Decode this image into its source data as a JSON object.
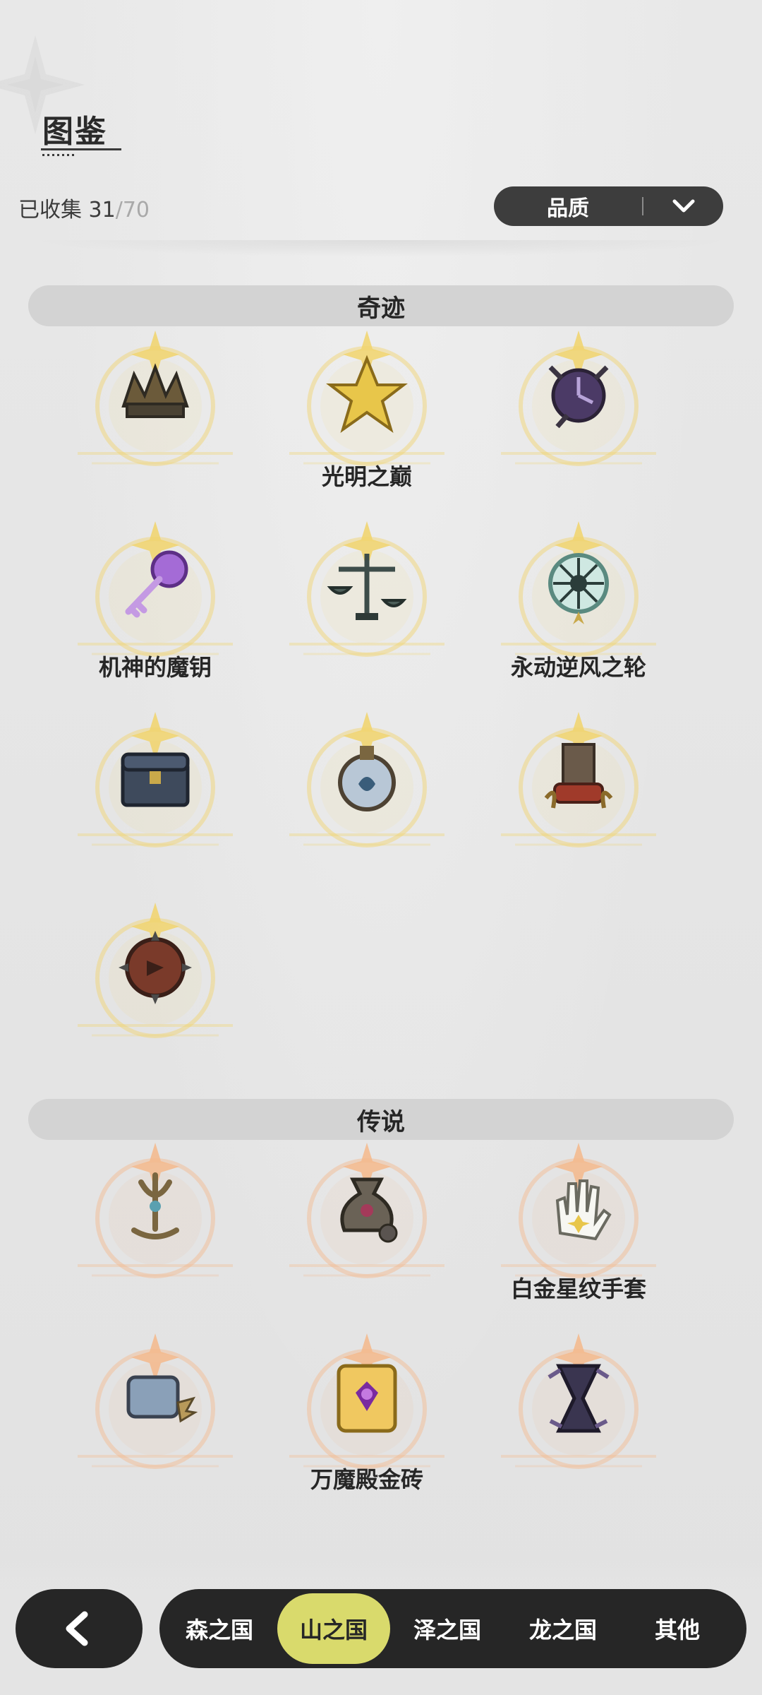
{
  "header": {
    "title": "图鉴",
    "collected_label": "已收集 31",
    "collected_total": "/70",
    "sort_label": "品质",
    "sort_icon": "chevron-down-icon"
  },
  "sections": [
    {
      "title": "奇迹",
      "items": [
        {
          "name": "",
          "icon": "bronze-broken-crown-icon",
          "accent": "#f1d36b"
        },
        {
          "name": "光明之巅",
          "icon": "golden-star-crystal-icon",
          "accent": "#f1d36b"
        },
        {
          "name": "",
          "icon": "purple-clock-icon",
          "accent": "#f1d36b"
        },
        {
          "name": "机神的魔钥",
          "icon": "purple-key-icon",
          "accent": "#f1d36b"
        },
        {
          "name": "",
          "icon": "bronze-scales-icon",
          "accent": "#f1d36b"
        },
        {
          "name": "永动逆风之轮",
          "icon": "wind-wheel-icon",
          "accent": "#f1d36b"
        },
        {
          "name": "",
          "icon": "treasure-chest-icon",
          "accent": "#f1d36b"
        },
        {
          "name": "",
          "icon": "flask-orb-icon",
          "accent": "#f1d36b"
        },
        {
          "name": "",
          "icon": "red-throne-icon",
          "accent": "#f1d36b"
        },
        {
          "name": "",
          "icon": "bronze-shield-icon",
          "accent": "#f1d36b"
        }
      ]
    },
    {
      "title": "传说",
      "items": [
        {
          "name": "",
          "icon": "bronze-trident-icon",
          "accent": "#f4b98b"
        },
        {
          "name": "",
          "icon": "bronze-sack-icon",
          "accent": "#f4b98b"
        },
        {
          "name": "白金星纹手套",
          "icon": "white-glove-icon",
          "accent": "#f4b98b"
        },
        {
          "name": "",
          "icon": "winged-scroll-icon",
          "accent": "#f4b98b"
        },
        {
          "name": "万魔殿金砖",
          "icon": "gold-book-icon",
          "accent": "#f4b98b"
        },
        {
          "name": "",
          "icon": "dark-hourglass-icon",
          "accent": "#f4b98b"
        }
      ]
    }
  ],
  "bottom_nav": {
    "back_icon": "back-arrow-icon",
    "tabs": [
      {
        "label": "森之国",
        "active": false
      },
      {
        "label": "山之国",
        "active": true
      },
      {
        "label": "泽之国",
        "active": false
      },
      {
        "label": "龙之国",
        "active": false
      },
      {
        "label": "其他",
        "active": false
      }
    ],
    "active_color": "#d9da6c"
  }
}
